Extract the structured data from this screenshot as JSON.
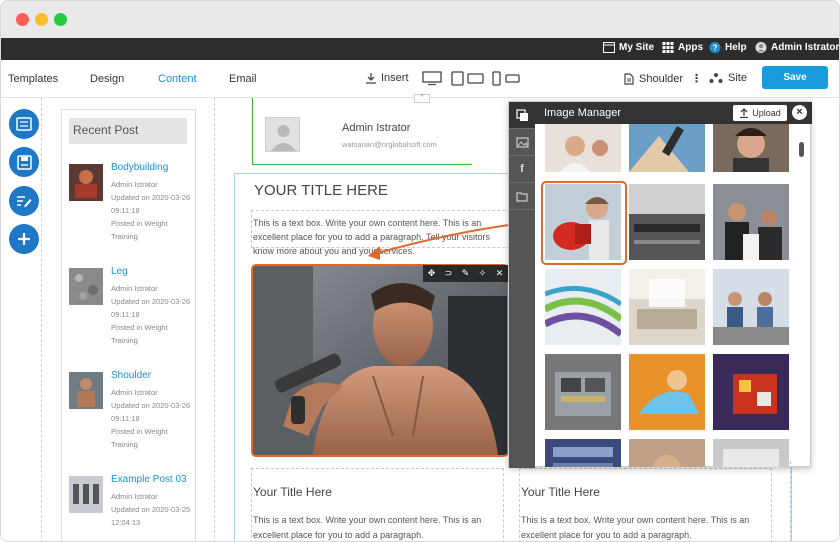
{
  "topbar": {
    "my_site": "My Site",
    "apps": "Apps",
    "help": "Help",
    "user": "Admin Istrator"
  },
  "toolbar": {
    "templates": "Templates",
    "design": "Design",
    "content": "Content",
    "email": "Email",
    "insert": "Insert",
    "page_select": "Shoulder",
    "site": "Site",
    "save": "Save"
  },
  "sidebar": {
    "heading": "Recent Post",
    "posts": [
      {
        "title": "Bodybuilding",
        "author": "Admin Istrator",
        "updated": "Updated on 2020-03-26 09:11:18",
        "category": "Posted in Weight Training"
      },
      {
        "title": "Leg",
        "author": "Admin Istrator",
        "updated": "Updated on 2020-03-26 09:11:18",
        "category": "Posted in Weight Training"
      },
      {
        "title": "Shoulder",
        "author": "Admin Istrator",
        "updated": "Updated on 2020-03-26 09:11:18",
        "category": "Posted in Weight Training"
      },
      {
        "title": "Example Post 03",
        "author": "Admin Istrator",
        "updated": "Updated on 2020-03-25 12:04:13",
        "category": ""
      }
    ]
  },
  "author": {
    "name": "Admin Istrator",
    "email": "watsanan@nrglobalsoft.com"
  },
  "content": {
    "title": "YOUR TITLE HERE",
    "text": "This is a text box. Write your own content here. This is an excellent place for you to add a paragraph. Tell your visitors know more about you and your services.",
    "col1_title": "Your Title Here",
    "col1_text": "This is a text box. Write your own content here. This is an excellent place for you to add a paragraph.",
    "col2_title": "Your Title Here",
    "col2_text": "This is a text box. Write your own content here. This is an excellent place for you to add a paragraph."
  },
  "image_manager": {
    "title": "Image Manager",
    "upload": "Upload"
  },
  "colors": {
    "accent": "#1a9bde",
    "selection": "#e06a2c",
    "dark_bar": "#2d2d2d"
  }
}
